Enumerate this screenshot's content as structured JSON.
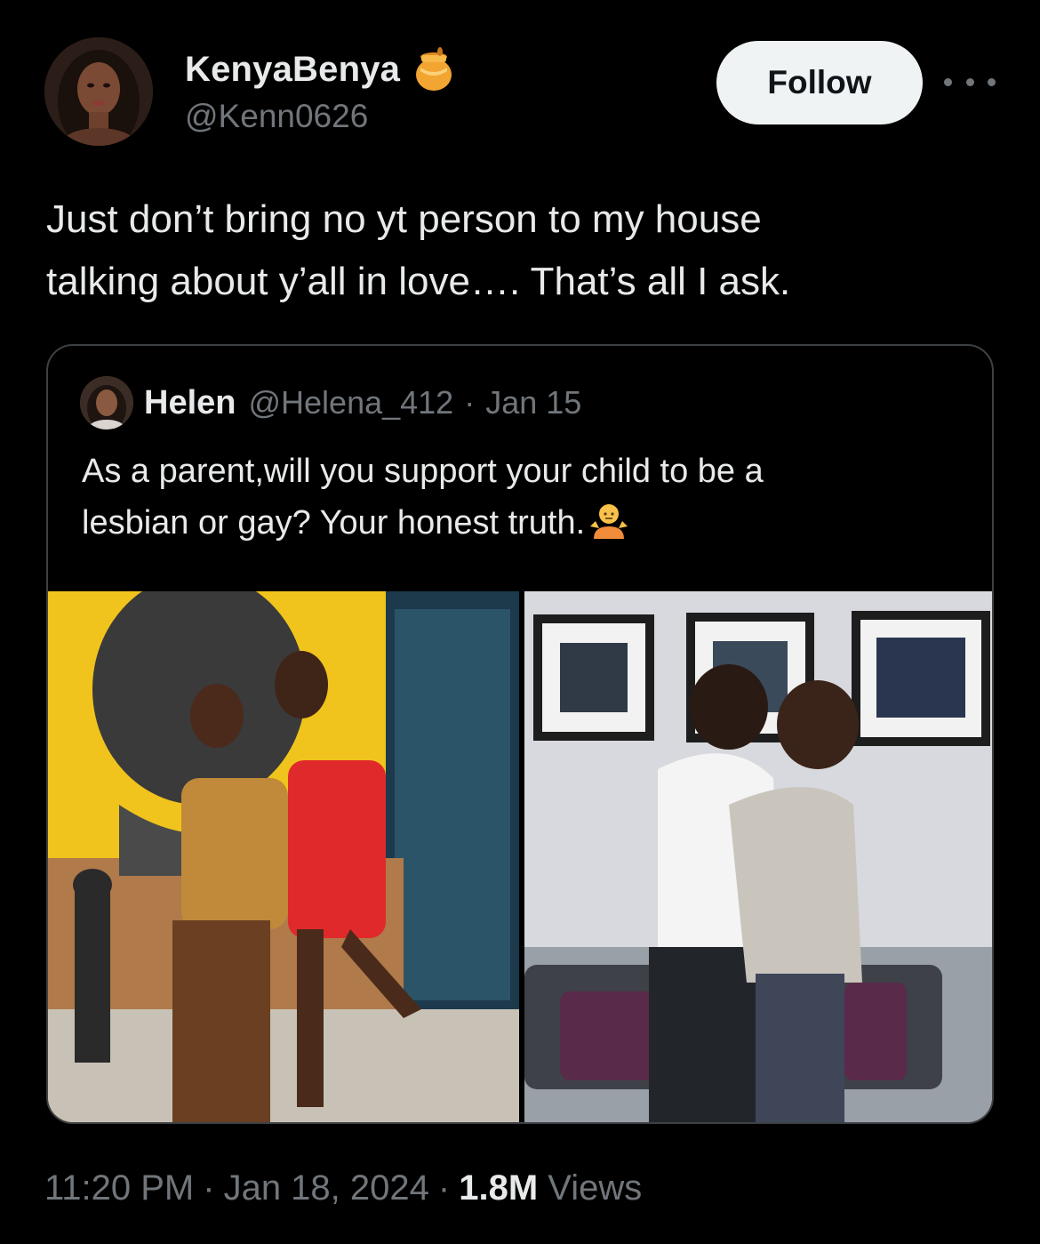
{
  "author": {
    "display_name": "KenyaBenya",
    "handle": "@Kenn0626",
    "badge_icon": "honey-pot-icon"
  },
  "actions": {
    "follow_label": "Follow",
    "more_icon": "more-horizontal-icon"
  },
  "tweet": {
    "text_lines": [
      "Just don’t bring no yt person to my house",
      "talking about y’all in love…. That’s all I ask."
    ]
  },
  "quoted_tweet": {
    "name": "Helen",
    "handle": "@Helena_412",
    "separator": "·",
    "date": "Jan 15",
    "text_lines": [
      "As a parent,will you support your child to be a",
      "lesbian or gay? Your honest truth."
    ],
    "emoji": "person-shrugging-emoji",
    "media": [
      "photo-couple-women",
      "photo-couple-men"
    ]
  },
  "meta": {
    "time": "11:20 PM",
    "separator": "·",
    "date": "Jan 18, 2024",
    "views_count": "1.8M",
    "views_label": "Views"
  },
  "colors": {
    "background": "#000000",
    "primary_text": "#e7e9ea",
    "secondary_text": "#71767b",
    "follow_button_bg": "#eff3f4",
    "border": "#3e4144"
  }
}
